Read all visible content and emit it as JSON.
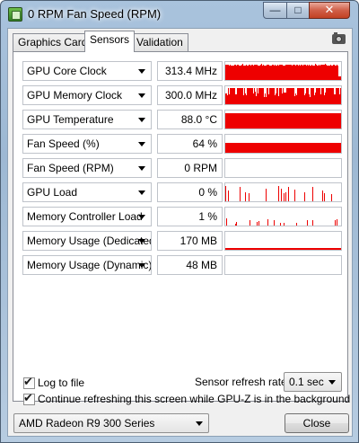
{
  "window": {
    "title": "0 RPM Fan Speed (RPM)"
  },
  "controls": {
    "minimize": "—",
    "maximize": "□",
    "close": "✕"
  },
  "tabs": [
    {
      "label": "Graphics Card",
      "active": false
    },
    {
      "label": "Sensors",
      "active": true
    },
    {
      "label": "Validation",
      "active": false
    }
  ],
  "icons": {
    "app": "gpu-z-icon",
    "screenshot": "camera-icon",
    "dropdown": "chevron-down-icon"
  },
  "colors": {
    "graph": "#ee0000"
  },
  "sensors": [
    {
      "name": "GPU Core Clock",
      "value": "313.4 MHz"
    },
    {
      "name": "GPU Memory Clock",
      "value": "300.0 MHz"
    },
    {
      "name": "GPU Temperature",
      "value": "88.0 °C"
    },
    {
      "name": "Fan Speed (%)",
      "value": "64 %"
    },
    {
      "name": "Fan Speed (RPM)",
      "value": "0 RPM"
    },
    {
      "name": "GPU Load",
      "value": "0 %"
    },
    {
      "name": "Memory Controller Load",
      "value": "1 %"
    },
    {
      "name": "Memory Usage (Dedicated)",
      "value": "170 MB"
    },
    {
      "name": "Memory Usage (Dynamic)",
      "value": "48 MB"
    }
  ],
  "options": {
    "log_to_file": {
      "label": "Log to file",
      "checked": true
    },
    "refresh_rate_label": "Sensor refresh rate:",
    "refresh_rate_value": "0.1 sec",
    "continue_refreshing": {
      "label": "Continue refreshing this screen while GPU-Z is in the background",
      "checked": true
    }
  },
  "footer": {
    "gpu_select": "AMD Radeon R9 300 Series",
    "close_label": "Close"
  }
}
